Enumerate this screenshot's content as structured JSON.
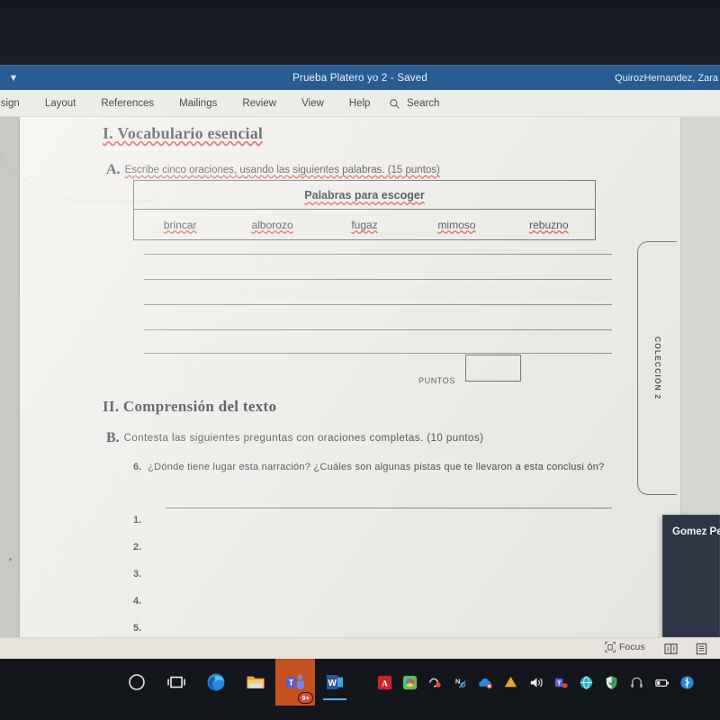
{
  "window": {
    "title": "Prueba Platero yo 2  -  Saved",
    "user": "QuirozHernandez, Zara",
    "qat_icon": "chevron-down-icon"
  },
  "ribbon": {
    "tabs": [
      {
        "label": "Design"
      },
      {
        "label": "Layout"
      },
      {
        "label": "References"
      },
      {
        "label": "Mailings"
      },
      {
        "label": "Review"
      },
      {
        "label": "View"
      },
      {
        "label": "Help"
      }
    ],
    "search": {
      "label": "Search",
      "icon": "search-icon"
    }
  },
  "document": {
    "section_one": {
      "heading": "I. Vocabulario esencial",
      "instruction_letter": "A.",
      "instruction_text": "Escribe cinco oraciones, usando las siguientes palabras. (15 puntos)",
      "wordbank": {
        "header": "Palabras para escoger",
        "words": [
          "brincar",
          "alborozo",
          "fugaz",
          "mimoso",
          "rebuzno"
        ]
      },
      "blank_line_count": 5,
      "puntos_label": "PUNTOS",
      "puntos_value": ""
    },
    "section_two": {
      "heading": "II. Comprensión del texto",
      "instruction_letter": "B.",
      "instruction_text": "Contesta  las siguientes  preguntas  con  oraciones  completas.  (10 puntos)",
      "question": {
        "number": "6.",
        "text": "¿Dónde  tiene  lugar  esta  narración?  ¿Cuáles  son  algunas  pistas  que  te  llevaron  a  esta  conclusi ón?"
      },
      "answer_numbers": [
        "1.",
        "2.",
        "3.",
        "4.",
        "5."
      ]
    },
    "side_tab_label": "COLECCIÓN 2"
  },
  "floating_panel": {
    "name": "Gomez Pe"
  },
  "statusbar": {
    "focus_label": "Focus",
    "focus_icon": "focus-icon",
    "view_icons": [
      "read-mode-icon",
      "print-layout-icon"
    ]
  },
  "taskbar": {
    "buttons": [
      {
        "name": "cortana-icon",
        "badge": "",
        "underline": false,
        "active": false
      },
      {
        "name": "task-view-icon",
        "badge": "",
        "underline": false,
        "active": false
      },
      {
        "name": "edge-icon",
        "badge": "",
        "underline": false,
        "active": false
      },
      {
        "name": "file-explorer-icon",
        "badge": "",
        "underline": true,
        "active": false
      },
      {
        "name": "teams-icon",
        "badge": "9+",
        "underline": false,
        "active": true
      },
      {
        "name": "word-icon",
        "badge": "",
        "underline": true,
        "active": false
      }
    ],
    "tray": [
      {
        "name": "adobe-acrobat-icon"
      },
      {
        "name": "photos-icon"
      },
      {
        "name": "goto-icon"
      },
      {
        "name": "snip-icon"
      },
      {
        "name": "onedrive-icon"
      },
      {
        "name": "drive-icon"
      },
      {
        "name": "volume-icon"
      },
      {
        "name": "teams-tray-icon"
      },
      {
        "name": "globe-icon"
      },
      {
        "name": "defender-shield-icon"
      },
      {
        "name": "headphones-icon"
      },
      {
        "name": "battery-icon"
      },
      {
        "name": "bluetooth-icon"
      }
    ]
  },
  "colors": {
    "titlebar": "#2a5b93",
    "ribbon": "#eeece7",
    "page": "#f1efe9",
    "taskbar": "#13161b",
    "teams_active": "#c4511f",
    "spellcheck": "#d23b2e"
  }
}
